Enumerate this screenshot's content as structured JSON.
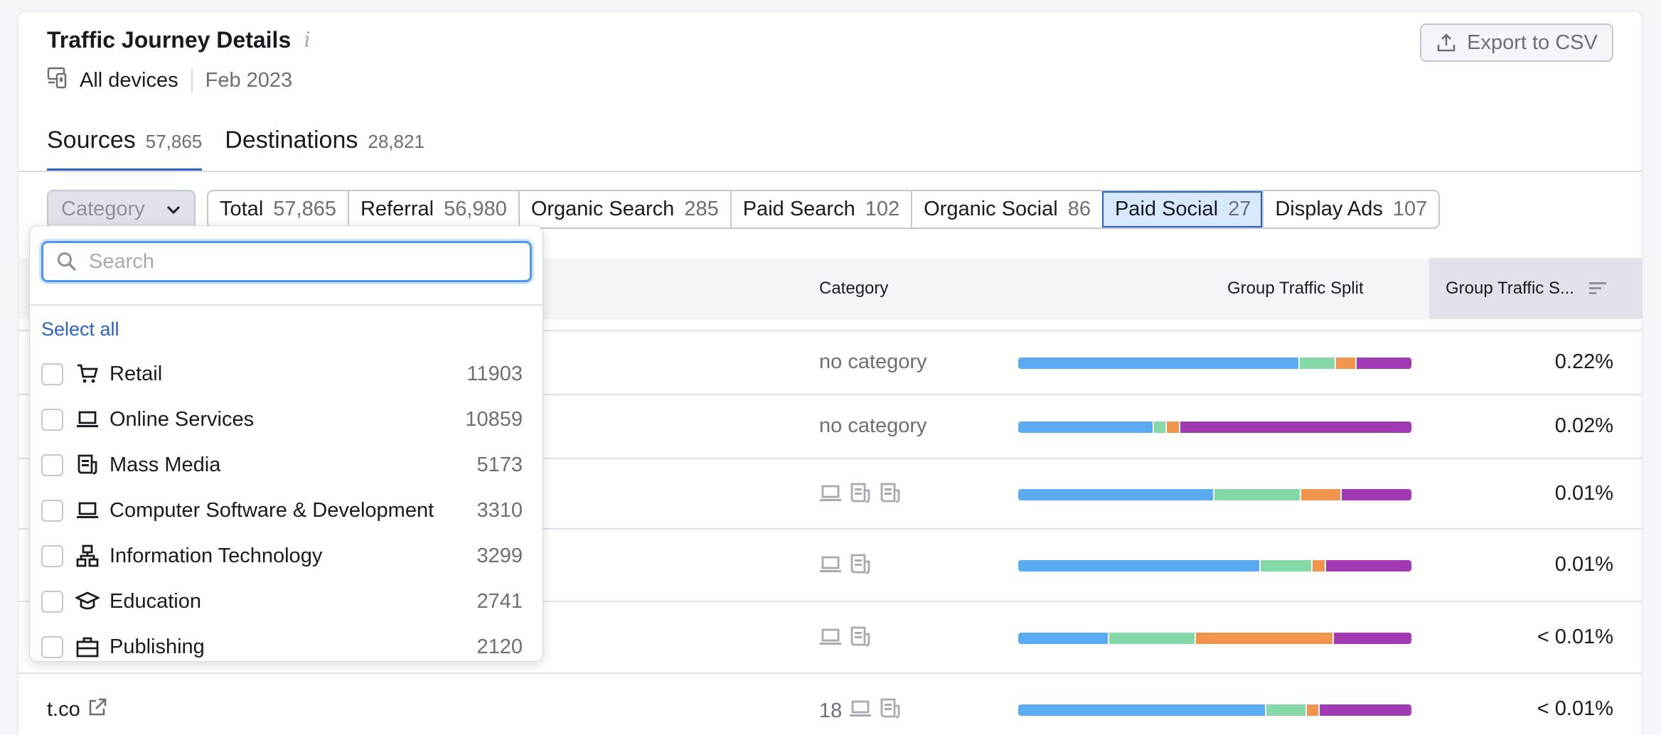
{
  "header": {
    "title": "Traffic Journey Details",
    "devices": "All devices",
    "date": "Feb 2023",
    "export_label": "Export to CSV"
  },
  "tabs": [
    {
      "label": "Sources",
      "count": "57,865",
      "active": true
    },
    {
      "label": "Destinations",
      "count": "28,821",
      "active": false
    }
  ],
  "filters": {
    "category_placeholder": "Category",
    "segments": [
      {
        "label": "Total",
        "count": "57,865"
      },
      {
        "label": "Referral",
        "count": "56,980"
      },
      {
        "label": "Organic Search",
        "count": "285"
      },
      {
        "label": "Paid Search",
        "count": "102"
      },
      {
        "label": "Organic Social",
        "count": "86"
      },
      {
        "label": "Paid Social",
        "count": "27",
        "active": true
      },
      {
        "label": "Display Ads",
        "count": "107"
      }
    ]
  },
  "table": {
    "columns": {
      "category": "Category",
      "split": "Group Traffic Split",
      "share": "Group Traffic S..."
    },
    "colors": {
      "seg1": "#5aabf2",
      "seg2": "#85d8a7",
      "seg3": "#f0944e",
      "seg4": "#a23ab3"
    },
    "rows": [
      {
        "domain": "",
        "category_text": "no category",
        "icons": [],
        "split": [
          0.72,
          0.09,
          0.05,
          0.14
        ],
        "share": "0.22%"
      },
      {
        "domain": "",
        "category_text": "no category",
        "icons": [],
        "split": [
          0.345,
          0.03,
          0.03,
          0.595
        ],
        "share": "0.02%"
      },
      {
        "domain": "",
        "category_text": "",
        "icons": [
          "laptop-icon",
          "newspaper-icon",
          "newspaper-icon"
        ],
        "split": [
          0.5,
          0.22,
          0.1,
          0.18
        ],
        "share": "0.01%"
      },
      {
        "domain": "",
        "category_text": "",
        "icons": [
          "laptop-icon",
          "newspaper-icon"
        ],
        "split": [
          0.62,
          0.13,
          0.03,
          0.22
        ],
        "share": "0.01%"
      },
      {
        "domain": "",
        "category_text": "",
        "icons": [
          "laptop-icon",
          "newspaper-icon"
        ],
        "split": [
          0.23,
          0.22,
          0.35,
          0.2
        ],
        "share": "< 0.01%"
      },
      {
        "domain": "t.co",
        "category_text": "18",
        "icons": [
          "laptop-icon",
          "newspaper-icon"
        ],
        "split": [
          0.635,
          0.1,
          0.03,
          0.235
        ],
        "share": "< 0.01%"
      }
    ]
  },
  "dropdown": {
    "search_placeholder": "Search",
    "select_all": "Select all",
    "items": [
      {
        "label": "Retail",
        "count": "11903",
        "icon": "cart-icon"
      },
      {
        "label": "Online Services",
        "count": "10859",
        "icon": "laptop-icon"
      },
      {
        "label": "Mass Media",
        "count": "5173",
        "icon": "newspaper-icon"
      },
      {
        "label": "Computer Software & Development",
        "count": "3310",
        "icon": "laptop-icon"
      },
      {
        "label": "Information Technology",
        "count": "3299",
        "icon": "network-icon"
      },
      {
        "label": "Education",
        "count": "2741",
        "icon": "graduation-cap-icon"
      },
      {
        "label": "Publishing",
        "count": "2120",
        "icon": "briefcase-icon"
      }
    ]
  }
}
